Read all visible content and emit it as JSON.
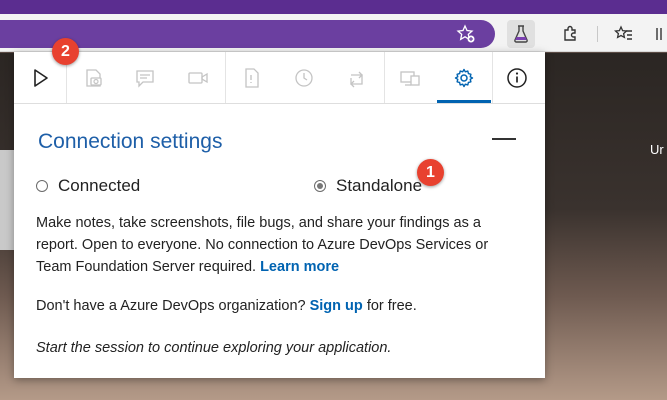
{
  "background": {
    "partial_text": "Ur"
  },
  "popup": {
    "toolbar": {
      "buttons": [
        {
          "name": "start-session",
          "icon": "play-icon"
        },
        {
          "name": "capture-screenshot",
          "icon": "camera-icon"
        },
        {
          "name": "capture-note",
          "icon": "note-icon"
        },
        {
          "name": "record-screen",
          "icon": "video-icon"
        },
        {
          "name": "file-bug",
          "icon": "document-icon"
        },
        {
          "name": "timer",
          "icon": "clock-icon"
        },
        {
          "name": "export-session",
          "icon": "loop-icon"
        },
        {
          "name": "device",
          "icon": "device-icon"
        },
        {
          "name": "settings",
          "icon": "gear-icon"
        },
        {
          "name": "info",
          "icon": "info-icon"
        }
      ]
    },
    "connection": {
      "title": "Connection settings",
      "options": [
        {
          "label": "Connected",
          "selected": false
        },
        {
          "label": "Standalone",
          "selected": true
        }
      ],
      "description": "Make notes, take screenshots, file bugs, and share your findings as a report. Open to everyone. No connection to Azure DevOps Services or Team Foundation Server required.",
      "learn_more": "Learn more",
      "signup_prefix": "Don't have a Azure DevOps organization?",
      "signup_link": "Sign up",
      "signup_suffix": "for free.",
      "start_hint": "Start the session to continue exploring your application."
    }
  },
  "badges": [
    "1",
    "2"
  ],
  "colors": {
    "accent": "#0063b1",
    "title": "#1e5fa8",
    "badge": "#e8412f",
    "browser_frame": "#5b2d90"
  }
}
